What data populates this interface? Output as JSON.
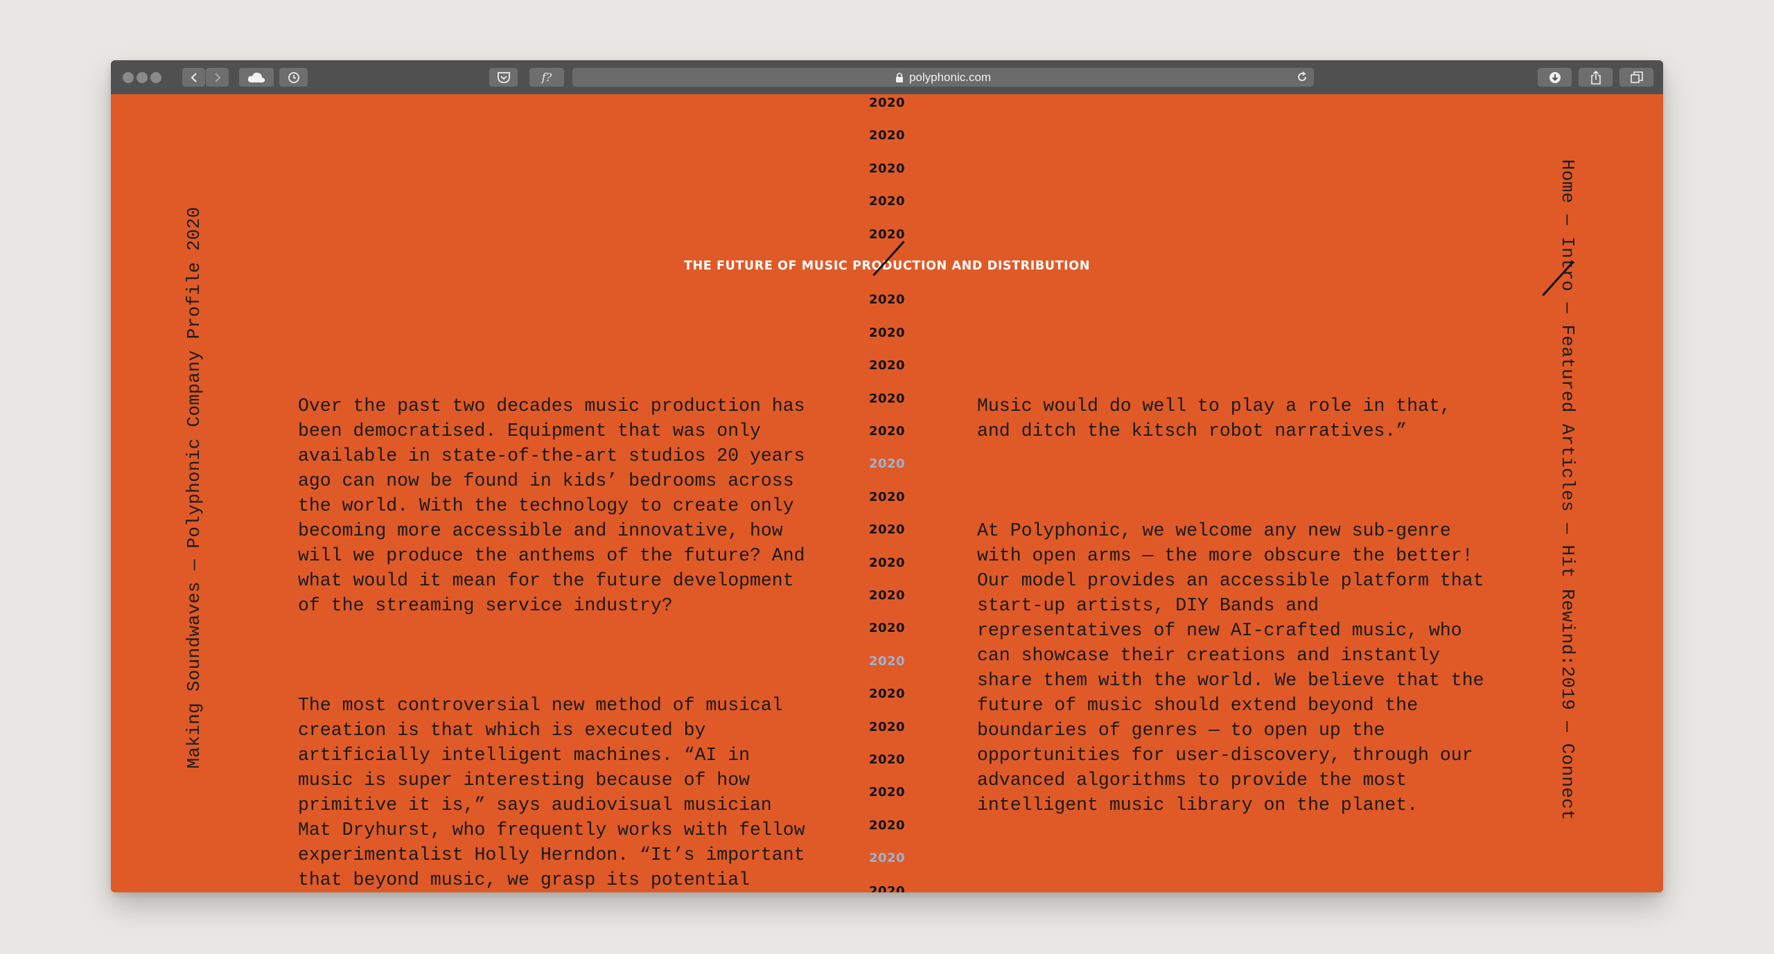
{
  "browser": {
    "url": "polyphonic.com",
    "font_button_label": "f?"
  },
  "page": {
    "left_vertical": "Making Soundwaves — Polyphonic Company Profile 2020",
    "nav": {
      "items": [
        "Home",
        "Intro",
        "Featured Articles",
        "Hit Rewind:2019",
        "Connect"
      ],
      "separator": " — "
    },
    "headline": "THE FUTURE OF MUSIC PRODUCTION AND DISTRIBUTION",
    "year_label": "2020",
    "year_rows": [
      false,
      false,
      false,
      false,
      false,
      false,
      false,
      false,
      false,
      false,
      false,
      true,
      false,
      false,
      false,
      false,
      false,
      true,
      false,
      false,
      false,
      false,
      false,
      true,
      false
    ],
    "left_column": {
      "paragraphs": [
        "Over the past two decades music production has\nbeen democratised. Equipment that was only\navailable in state-of-the-art studios 20 years\nago can now be found in kids’ bedrooms across\nthe world. With the technology to create only\nbecoming more accessible and innovative, how\nwill we produce the anthems of the future? And\nwhat would it mean for the future development\nof the streaming service industry?",
        "The most controversial new method of musical\ncreation is that which is executed by\nartificially intelligent machines. “AI in\nmusic is super interesting because of how\nprimitive it is,” says audiovisual musician\nMat Dryhurst, who frequently works with fellow\nexperimentalist Holly Herndon. “It’s important\nthat beyond music, we grasp its potential\nimplications and our agency in that process."
      ]
    },
    "right_column": {
      "paragraphs": [
        "Music would do well to play a role in that,\nand ditch the kitsch robot narratives.”",
        "At Polyphonic, we welcome any new sub-genre\nwith open arms — the more obscure the better!\nOur model provides an accessible platform that\nstart-up artists, DIY Bands and\nrepresentatives of new AI-crafted music, who\ncan showcase their creations and instantly\nshare them with the world. We believe that the\nfuture of music should extend beyond the\nboundaries of genres — to open up the\nopportunities for user-discovery, through our\nadvanced algorithms to provide the most\nintelligent music library on the planet."
      ]
    },
    "colors": {
      "background": "#e05a27",
      "text": "#1a1a1a",
      "headline": "#ffffff",
      "year_highlight": "#9bb3d1"
    }
  }
}
